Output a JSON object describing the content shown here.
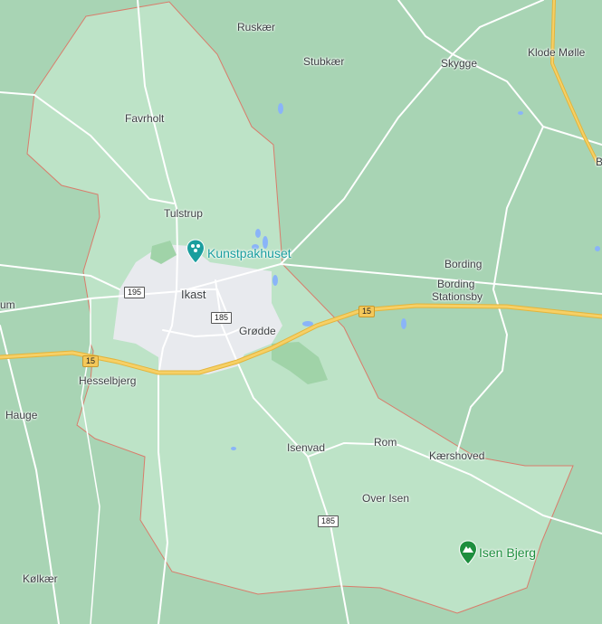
{
  "map": {
    "colors": {
      "outside": "#a8d4b4",
      "region": "#bde3c7",
      "urban": "#e8eaee",
      "water": "#8ab4f8",
      "boundary": "#d97c6b",
      "major_road": "#f6c347",
      "minor_road": "#ffffff",
      "poi_teal": "#1a9e9e",
      "poi_green": "#1e8e3e"
    },
    "places": {
      "ruskaer": "Ruskær",
      "stubkaer": "Stubkær",
      "skygge": "Skygge",
      "klode_molle": "Klode Mølle",
      "favrholt": "Favrholt",
      "tulstrup": "Tulstrup",
      "ikast": "Ikast",
      "grodde": "Grødde",
      "bording": "Bording",
      "bording_stationsby_1": "Bording",
      "bording_stationsby_2": "Stationsby",
      "um": "um",
      "hesselbjerg": "Hesselbjerg",
      "hauge": "Hauge",
      "isenvad": "Isenvad",
      "rom": "Rom",
      "kaershoved": "Kærshoved",
      "over_isen": "Over Isen",
      "kolkaer": "Kølkær",
      "edge_b": "B"
    },
    "pois": {
      "kunstpakhuset": "Kunstpakhuset",
      "isen_bjerg": "Isen Bjerg"
    },
    "shields": {
      "r195": "195",
      "r185_top": "185",
      "r15_left": "15",
      "r15_right": "15",
      "r185_bottom": "185"
    },
    "icons": {
      "kunstpakhuset": "museum-pin-icon",
      "isen_bjerg": "mountain-pin-icon"
    }
  }
}
